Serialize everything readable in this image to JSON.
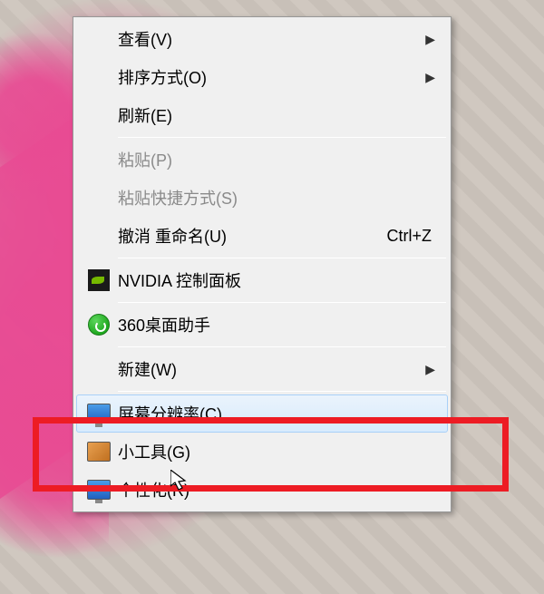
{
  "menu": {
    "view": {
      "label": "查看(V)"
    },
    "sort": {
      "label": "排序方式(O)"
    },
    "refresh": {
      "label": "刷新(E)"
    },
    "paste": {
      "label": "粘贴(P)"
    },
    "paste_shortcut": {
      "label": "粘贴快捷方式(S)"
    },
    "undo_rename": {
      "label": "撤消 重命名(U)",
      "shortcut": "Ctrl+Z"
    },
    "nvidia": {
      "label": "NVIDIA 控制面板"
    },
    "desk360": {
      "label": "360桌面助手"
    },
    "new": {
      "label": "新建(W)"
    },
    "resolution": {
      "label": "屏幕分辨率(C)"
    },
    "gadgets_partial": {
      "label": "小工具(G)"
    },
    "personalize": {
      "label": "个性化(R)"
    }
  }
}
